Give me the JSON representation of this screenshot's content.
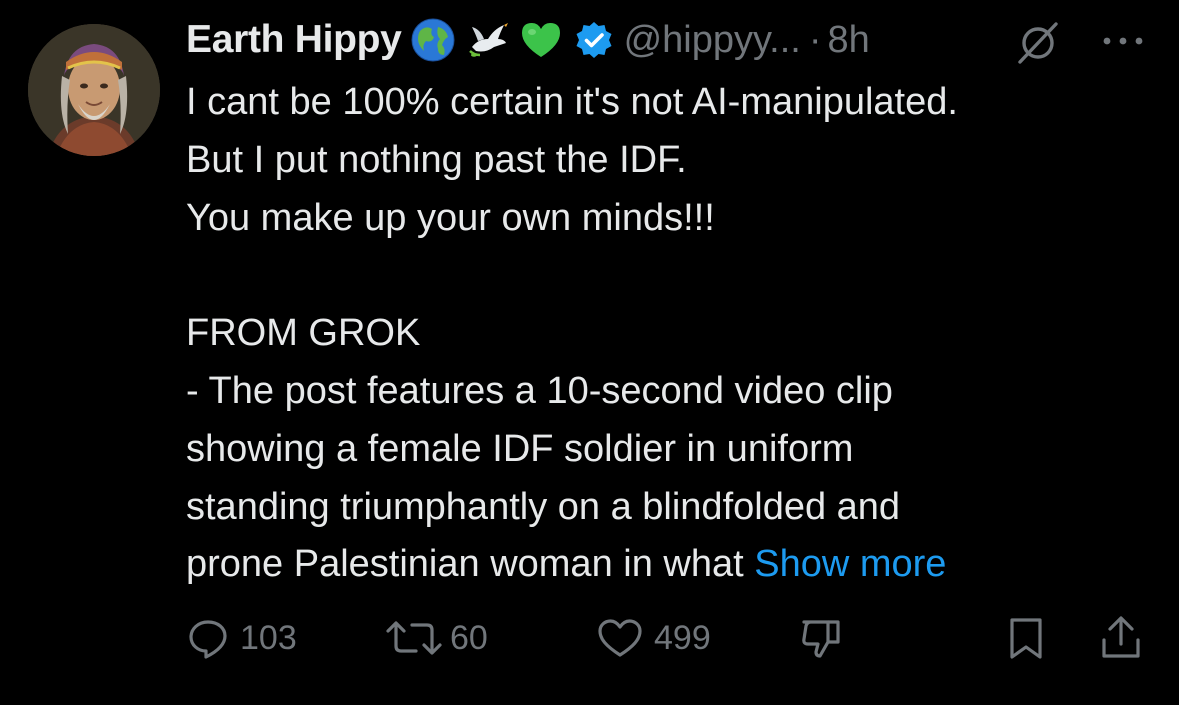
{
  "author": {
    "display_name": "Earth Hippy",
    "handle": "@hippyy...",
    "separator": "·",
    "time": "8h",
    "name_emojis": [
      "globe-icon",
      "dove-icon",
      "green-heart-icon"
    ],
    "verified_color": "#1d9bf0"
  },
  "tweet": {
    "lines": [
      "I cant be 100% certain it's not AI-manipulated.",
      "But I put nothing past the IDF.",
      "You make up your own minds!!!",
      "",
      "FROM GROK",
      "- The post features a 10-second video clip",
      "showing a female IDF soldier in uniform",
      "standing triumphantly on a blindfolded and",
      "prone Palestinian woman in what"
    ],
    "show_more": "Show more"
  },
  "actions": {
    "replies": "103",
    "reposts": "60",
    "likes": "499"
  },
  "colors": {
    "background": "#000000",
    "text": "#e7e9ea",
    "muted": "#71767b",
    "link": "#1d9bf0"
  }
}
